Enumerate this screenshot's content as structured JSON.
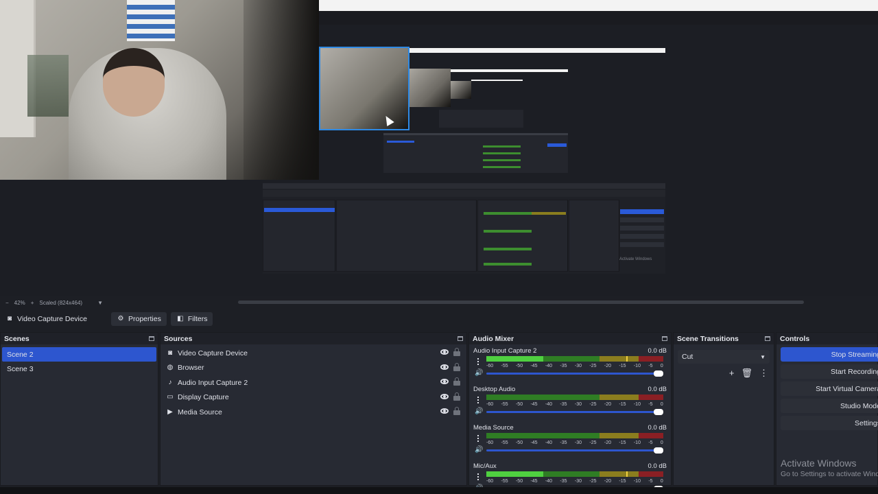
{
  "preview": {
    "nested_watermark": "Activate Windows"
  },
  "zoom": {
    "level": "42%",
    "scale_label": "Scaled (824x464)"
  },
  "source_toolbar": {
    "source_name": "Video Capture Device",
    "properties_label": "Properties",
    "filters_label": "Filters"
  },
  "scenes": {
    "title": "Scenes",
    "items": [
      "Scene 2",
      "Scene 3"
    ],
    "selected": "Scene 2"
  },
  "sources": {
    "title": "Sources",
    "items": [
      {
        "label": "Video Capture Device",
        "icon": "camera-icon"
      },
      {
        "label": "Browser",
        "icon": "globe-icon"
      },
      {
        "label": "Audio Input Capture 2",
        "icon": "microphone-icon"
      },
      {
        "label": "Display Capture",
        "icon": "monitor-icon"
      },
      {
        "label": "Media Source",
        "icon": "play-icon"
      }
    ]
  },
  "mixer": {
    "title": "Audio Mixer",
    "ticks": [
      "-60",
      "-55",
      "-50",
      "-45",
      "-40",
      "-35",
      "-30",
      "-25",
      "-20",
      "-15",
      "-10",
      "-5",
      "0"
    ],
    "channels": [
      {
        "name": "Audio Input Capture 2",
        "db": "0.0 dB",
        "level": 0.32,
        "peak": 0.79
      },
      {
        "name": "Desktop Audio",
        "db": "0.0 dB",
        "level": 0.0,
        "peak": 0.0
      },
      {
        "name": "Media Source",
        "db": "0.0 dB",
        "level": 0.0,
        "peak": 0.0
      },
      {
        "name": "Mic/Aux",
        "db": "0.0 dB",
        "level": 0.32,
        "peak": 0.79
      }
    ]
  },
  "transitions": {
    "title": "Scene Transitions",
    "selected": "Cut"
  },
  "controls": {
    "title": "Controls",
    "buttons": [
      "Stop Streaming",
      "Start Recording",
      "Start Virtual Camera",
      "Studio Mode",
      "Settings"
    ]
  },
  "watermark": {
    "line1": "Activate Windows",
    "line2": "Go to Settings to activate Windows."
  },
  "colors": {
    "accent": "#2d56cf",
    "panel": "#272a33",
    "meter_green": "#4fd040"
  }
}
